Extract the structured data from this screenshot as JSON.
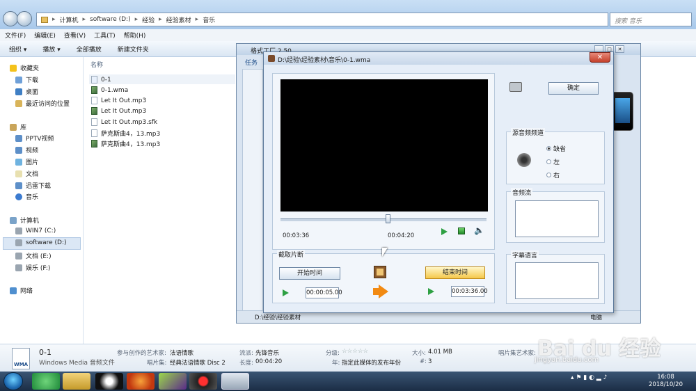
{
  "explorer": {
    "breadcrumb": [
      "计算机",
      "software (D:)",
      "经验",
      "经验素材",
      "音乐"
    ],
    "search_placeholder": "搜索 音乐",
    "menu": [
      "文件(F)",
      "编辑(E)",
      "查看(V)",
      "工具(T)",
      "帮助(H)"
    ],
    "commands": [
      "组织 ▾",
      "播放 ▾",
      "全部播放",
      "新建文件夹"
    ],
    "nav": {
      "favorites": "收藏夹",
      "fav_items": [
        "下载",
        "桌面",
        "最近访问的位置"
      ],
      "libraries": "库",
      "lib_items": [
        "PPTV视频",
        "视频",
        "图片",
        "文档",
        "迅雷下载",
        "音乐"
      ],
      "computer": "计算机",
      "drives": [
        "WIN7 (C:)",
        "software (D:)",
        "文档 (E:)",
        "娱乐 (F:)"
      ],
      "network": "网络"
    },
    "column_name": "名称",
    "files": [
      "0-1",
      "0-1.wma",
      "Let It Out.mp3",
      "Let It Out.mp3",
      "Let It Out.mp3.sfk",
      "萨克斯曲4，13.mp3",
      "萨克斯曲4，13.mp3"
    ]
  },
  "details": {
    "name": "0-1",
    "type": "Windows Media 音频文件",
    "artist_label": "参与创作的艺术家:",
    "artist": "法语情歌",
    "album_label": "唱片集:",
    "album": "经典法语情歌 Disc 2",
    "genre_label": "流派:",
    "genre": "先锋音乐",
    "length_label": "长度:",
    "length": "00:04:20",
    "rating_label": "分级:",
    "rating": "☆☆☆☆☆",
    "year_label": "年:",
    "year": "指定此媒体的发布年份",
    "size_label": "大小:",
    "size": "4.01 MB",
    "track_label": "#:",
    "track": "3",
    "album_artist_label": "唱片集艺术家:"
  },
  "format_factory": {
    "title": "格式工厂 2.50",
    "tab": "任务",
    "status_left": "D:\\经验\\经验素材",
    "status_right": "电脑"
  },
  "dialog": {
    "title": "D:\\经验\\经验素材\\音乐\\0-1.wma",
    "ok": "确定",
    "time_current": "00:03:36",
    "time_total": "00:04:20",
    "slider_fraction": 0.53,
    "clip_group": "截取片断",
    "start_btn": "开始时间",
    "end_btn": "结束时间",
    "start_time": "00:00:05.00",
    "end_time": "00:03:36.00",
    "source_channel": "源音频频道",
    "channels": [
      "缺省",
      "左",
      "右"
    ],
    "audio_stream": "音频流",
    "subtitle_lang": "字幕语言"
  },
  "taskbar": {
    "time": "16:08",
    "date": "2018/10/20"
  },
  "watermark": {
    "brand": "Bai du 经验",
    "url": "jingyan.baidu.com"
  }
}
